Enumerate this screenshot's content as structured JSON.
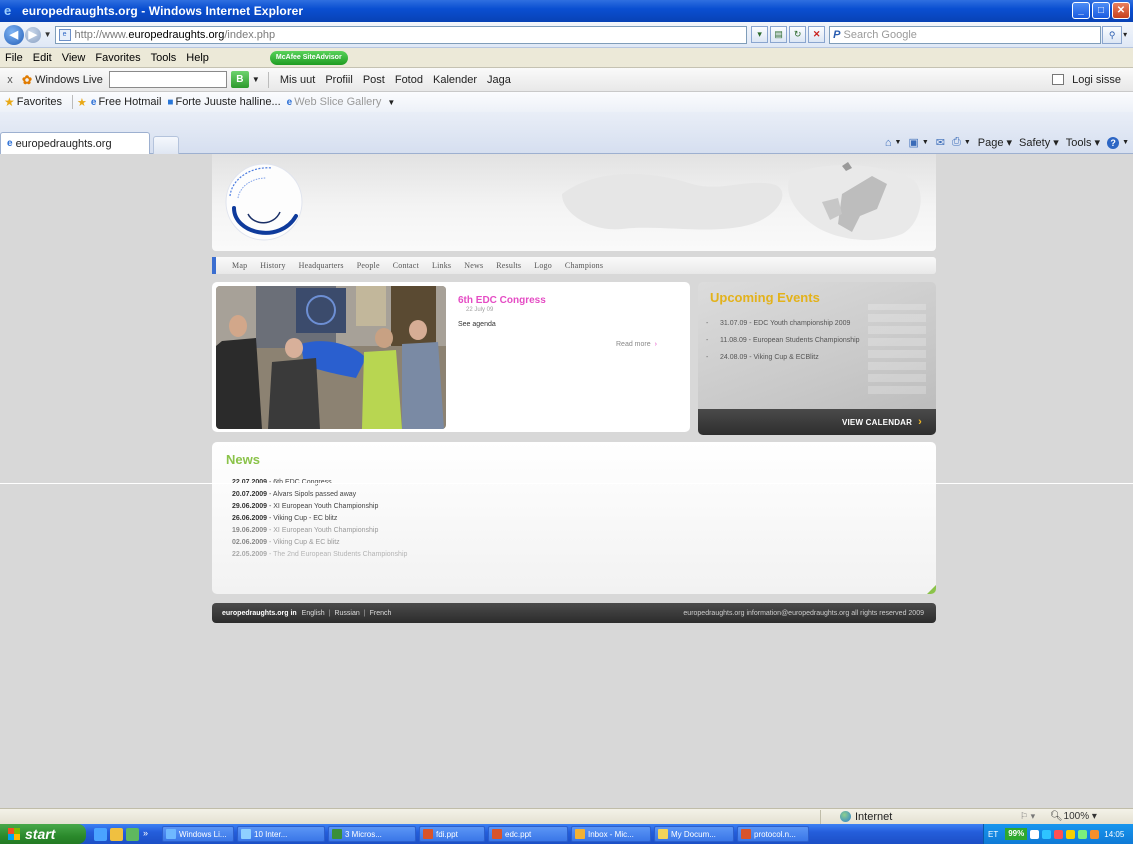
{
  "window": {
    "title": "europedraughts.org - Windows Internet Explorer",
    "buttons": [
      "_",
      "□",
      "✕"
    ]
  },
  "address": {
    "url_prefix": "http://www.",
    "url_host": "europedraughts.org",
    "url_path": "/index.php",
    "search_placeholder": "Search Google"
  },
  "menu": {
    "items": [
      "File",
      "Edit",
      "View",
      "Favorites",
      "Tools",
      "Help"
    ],
    "mcafee_label": "McAfee SiteAdvisor"
  },
  "windows_live": {
    "close": "x",
    "label": "Windows Live",
    "links": [
      "Mis uut",
      "Profiil",
      "Post",
      "Fotod",
      "Kalender",
      "Jaga"
    ],
    "signin": "Logi sisse"
  },
  "favorites": {
    "label": "Favorites",
    "links": [
      "Free Hotmail",
      "Forte Juuste halline...",
      "Web Slice Gallery"
    ]
  },
  "tab": {
    "title": "europedraughts.org"
  },
  "command_bar": {
    "page": "Page",
    "safety": "Safety",
    "tools": "Tools"
  },
  "site": {
    "nav": [
      "Map",
      "History",
      "Headquarters",
      "People",
      "Contact",
      "Links",
      "News",
      "Results",
      "Logo",
      "Champions"
    ],
    "feature": {
      "title": "6th EDC Congress",
      "date": "22 July 09",
      "text": "See agenda",
      "read_more": "Read more"
    },
    "events": {
      "title": "Upcoming Events",
      "items": [
        "31.07.09 - EDC Youth championship 2009",
        "11.08.09 - European Students Championship",
        "24.08.09 - Viking Cup & ECBlitz"
      ],
      "calendar_button": "VIEW CALENDAR"
    },
    "news": {
      "title": "News",
      "items": [
        {
          "date": "22.07.2009",
          "text": " - 6th EDC Congress"
        },
        {
          "date": "20.07.2009",
          "text": " - Alvars Sipols passed away"
        },
        {
          "date": "29.06.2009",
          "text": " - XI European Youth Championship"
        },
        {
          "date": "26.06.2009",
          "text": " - Viking Cup - EC blitz"
        },
        {
          "date": "19.06.2009",
          "text": " - XI European Youth Championship"
        },
        {
          "date": "02.06.2009",
          "text": " - Viking Cup & EC blitz"
        },
        {
          "date": "22.05.2009",
          "text": " - The 2nd European Students Championship"
        }
      ]
    },
    "footer": {
      "site_label": "europedraughts.org in",
      "languages": [
        "English",
        "Russian",
        "French"
      ],
      "right_text": "europedraughts.org   information@europedraughts.org   all rights reserved   2009"
    }
  },
  "status": {
    "zone": "Internet",
    "zoom": "100%"
  },
  "taskbar": {
    "start": "start",
    "tasks": [
      "Windows Li...",
      "10 Inter...",
      "3 Micros...",
      "fdi.ppt",
      "edc.ppt",
      "Inbox - Mic...",
      "My Docum...",
      "protocol.n..."
    ],
    "language": "ET",
    "battery": "99%",
    "clock": "14:05"
  },
  "colors": {
    "accent_pink": "#e54cc4",
    "accent_gold": "#e3b21b",
    "accent_green": "#8bc34a",
    "nav_blue": "#3b6ed0"
  }
}
